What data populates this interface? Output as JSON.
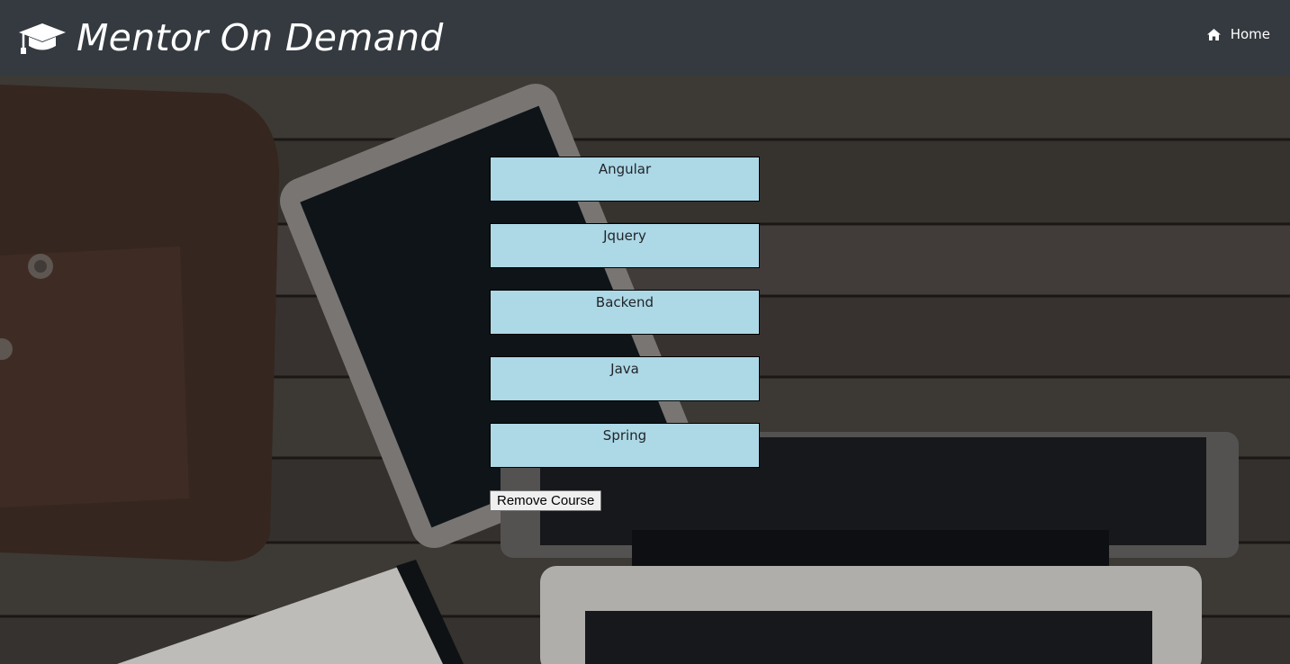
{
  "app": {
    "title": "Mentor On Demand",
    "logo_icon": "graduation-cap-icon"
  },
  "nav": {
    "home_label": "Home",
    "home_icon": "home-icon"
  },
  "courses": [
    {
      "label": "Angular"
    },
    {
      "label": "Jquery"
    },
    {
      "label": "Backend"
    },
    {
      "label": "Java"
    },
    {
      "label": "Spring"
    }
  ],
  "actions": {
    "remove_label": "Remove Course"
  },
  "colors": {
    "navbar": "#343a40",
    "course_item_bg": "#add8e6",
    "text_on_dark": "#ffffff"
  }
}
